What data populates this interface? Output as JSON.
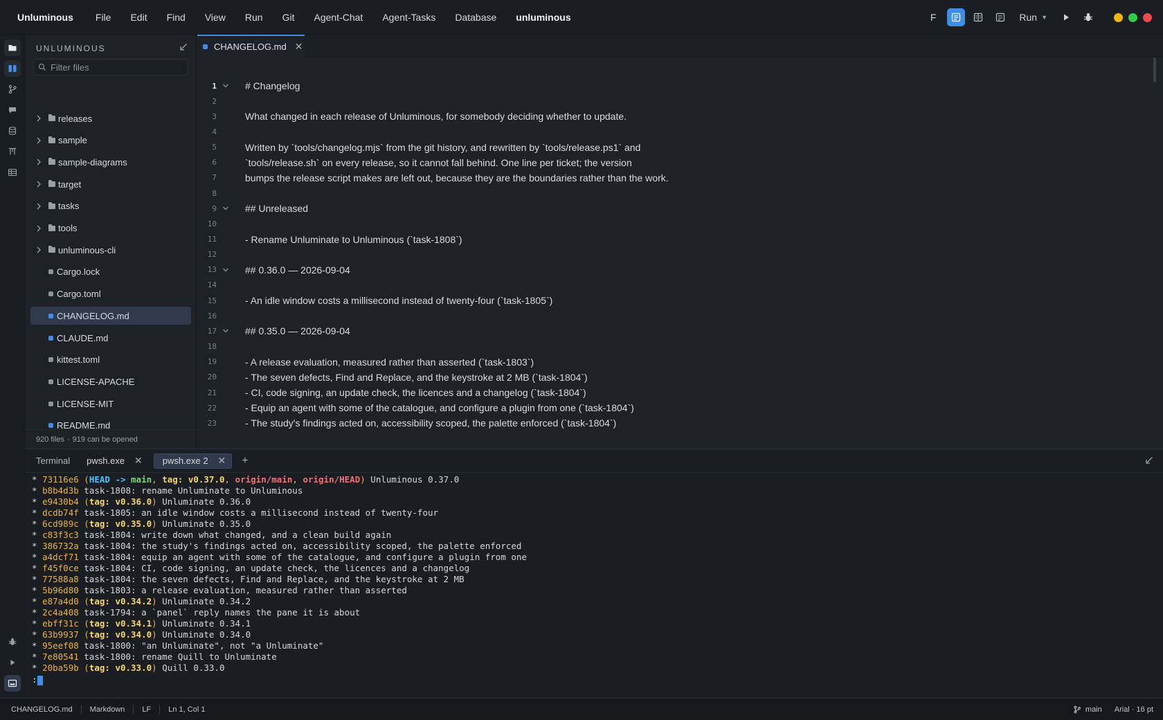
{
  "menubar": {
    "app_name": "Unluminous",
    "items": [
      "File",
      "Edit",
      "Find",
      "View",
      "Run",
      "Git",
      "Agent-Chat",
      "Agent-Tasks",
      "Database"
    ],
    "project_name": "unluminous",
    "font_toggle": "F",
    "run_label": "Run",
    "traffic_colors": [
      "#f5b400",
      "#2ec94a",
      "#f2494a"
    ],
    "accent": "#3e8ee9"
  },
  "sidebar": {
    "title": "UNLUMINOUS",
    "filter_placeholder": "Filter files",
    "items": [
      {
        "label": "releases",
        "kind": "folder"
      },
      {
        "label": "sample",
        "kind": "folder"
      },
      {
        "label": "sample-diagrams",
        "kind": "folder"
      },
      {
        "label": "target",
        "kind": "folder"
      },
      {
        "label": "tasks",
        "kind": "folder"
      },
      {
        "label": "tools",
        "kind": "folder"
      },
      {
        "label": "unluminous-cli",
        "kind": "folder"
      },
      {
        "label": "Cargo.lock",
        "kind": "file",
        "color": "#8d939b"
      },
      {
        "label": "Cargo.toml",
        "kind": "file",
        "color": "#8d939b"
      },
      {
        "label": "CHANGELOG.md",
        "kind": "file",
        "color": "#3e8ee9",
        "selected": true
      },
      {
        "label": "CLAUDE.md",
        "kind": "file",
        "color": "#3e8ee9"
      },
      {
        "label": "kittest.toml",
        "kind": "file",
        "color": "#8d939b"
      },
      {
        "label": "LICENSE-APACHE",
        "kind": "file",
        "color": "#8d939b"
      },
      {
        "label": "LICENSE-MIT",
        "kind": "file",
        "color": "#8d939b"
      },
      {
        "label": "README.md",
        "kind": "file",
        "color": "#3e8ee9"
      }
    ],
    "footer_files": "920 files",
    "footer_openable": "919 can be opened"
  },
  "editor": {
    "tab_name": "CHANGELOG.md",
    "lines": [
      {
        "n": "1",
        "text": "# Changelog",
        "fold": true
      },
      {
        "n": "2",
        "text": ""
      },
      {
        "n": "3",
        "text": "What changed in each release of Unluminous, for somebody deciding whether to update."
      },
      {
        "n": "4",
        "text": ""
      },
      {
        "n": "5",
        "text": "Written by `tools/changelog.mjs` from the git history, and rewritten by `tools/release.ps1` and"
      },
      {
        "n": "6",
        "text": "`tools/release.sh` on every release, so it cannot fall behind. One line per ticket; the version"
      },
      {
        "n": "7",
        "text": "bumps the release script makes are left out, because they are the boundaries rather than the work."
      },
      {
        "n": "8",
        "text": ""
      },
      {
        "n": "9",
        "text": "## Unreleased",
        "fold": true
      },
      {
        "n": "10",
        "text": ""
      },
      {
        "n": "11",
        "text": "- Rename Unluminate to Unluminous (`task-1808`)"
      },
      {
        "n": "12",
        "text": ""
      },
      {
        "n": "13",
        "text": "## 0.36.0 — 2026-09-04",
        "fold": true
      },
      {
        "n": "14",
        "text": ""
      },
      {
        "n": "15",
        "text": "- An idle window costs a millisecond instead of twenty-four (`task-1805`)"
      },
      {
        "n": "16",
        "text": ""
      },
      {
        "n": "17",
        "text": "## 0.35.0 — 2026-09-04",
        "fold": true
      },
      {
        "n": "18",
        "text": ""
      },
      {
        "n": "19",
        "text": "- A release evaluation, measured rather than asserted (`task-1803`)"
      },
      {
        "n": "20",
        "text": "- The seven defects, Find and Replace, and the keystroke at 2 MB (`task-1804`)"
      },
      {
        "n": "21",
        "text": "- CI, code signing, an update check, the licences and a changelog (`task-1804`)"
      },
      {
        "n": "22",
        "text": "- Equip an agent with some of the catalogue, and configure a plugin from one (`task-1804`)"
      },
      {
        "n": "23",
        "text": "- The study's findings acted on, accessibility scoped, the palette enforced (`task-1804`)"
      }
    ]
  },
  "terminal": {
    "label": "Terminal",
    "tabs": [
      "pwsh.exe",
      "pwsh.exe 2"
    ],
    "active_tab": 1,
    "prompt": ":",
    "log": [
      {
        "hash": "73116e6",
        "refs": [
          {
            "t": "head",
            "v": "HEAD -> "
          },
          {
            "t": "branch",
            "v": "main"
          },
          {
            "t": "sep",
            "v": ", "
          },
          {
            "t": "tag",
            "v": "tag: v0.37.0"
          },
          {
            "t": "sep",
            "v": ", "
          },
          {
            "t": "remote",
            "v": "origin/main"
          },
          {
            "t": "sep",
            "v": ", "
          },
          {
            "t": "remote",
            "v": "origin/HEAD"
          }
        ],
        "msg": "Unluminous 0.37.0"
      },
      {
        "hash": "b8b4d3b",
        "msg": "task-1808: rename Unluminate to Unluminous"
      },
      {
        "hash": "e9430b4",
        "refs": [
          {
            "t": "tag",
            "v": "tag: v0.36.0"
          }
        ],
        "msg": "Unluminate 0.36.0"
      },
      {
        "hash": "dcdb74f",
        "msg": "task-1805: an idle window costs a millisecond instead of twenty-four"
      },
      {
        "hash": "6cd989c",
        "refs": [
          {
            "t": "tag",
            "v": "tag: v0.35.0"
          }
        ],
        "msg": "Unluminate 0.35.0"
      },
      {
        "hash": "c83f3c3",
        "msg": "task-1804: write down what changed, and a clean build again"
      },
      {
        "hash": "386732a",
        "msg": "task-1804: the study's findings acted on, accessibility scoped, the palette enforced"
      },
      {
        "hash": "a4dcf71",
        "msg": "task-1804: equip an agent with some of the catalogue, and configure a plugin from one"
      },
      {
        "hash": "f45f0ce",
        "msg": "task-1804: CI, code signing, an update check, the licences and a changelog"
      },
      {
        "hash": "77588a8",
        "msg": "task-1804: the seven defects, Find and Replace, and the keystroke at 2 MB"
      },
      {
        "hash": "5b96d80",
        "msg": "task-1803: a release evaluation, measured rather than asserted"
      },
      {
        "hash": "e87a4d0",
        "refs": [
          {
            "t": "tag",
            "v": "tag: v0.34.2"
          }
        ],
        "msg": "Unluminate 0.34.2"
      },
      {
        "hash": "2c4a408",
        "msg": "task-1794: a `panel` reply names the pane it is about"
      },
      {
        "hash": "ebff31c",
        "refs": [
          {
            "t": "tag",
            "v": "tag: v0.34.1"
          }
        ],
        "msg": "Unluminate 0.34.1"
      },
      {
        "hash": "63b9937",
        "refs": [
          {
            "t": "tag",
            "v": "tag: v0.34.0"
          }
        ],
        "msg": "Unluminate 0.34.0"
      },
      {
        "hash": "95eef08",
        "msg": "task-1800: \"an Unluminate\", not \"a Unluminate\""
      },
      {
        "hash": "7e80541",
        "msg": "task-1800: rename Quill to Unluminate"
      },
      {
        "hash": "20ba59b",
        "refs": [
          {
            "t": "tag",
            "v": "tag: v0.33.0"
          }
        ],
        "msg": "Quill 0.33.0"
      }
    ]
  },
  "statusbar": {
    "file": "CHANGELOG.md",
    "language": "Markdown",
    "eol": "LF",
    "position": "Ln 1, Col 1",
    "branch": "main",
    "font": "Arial · 16 pt"
  }
}
